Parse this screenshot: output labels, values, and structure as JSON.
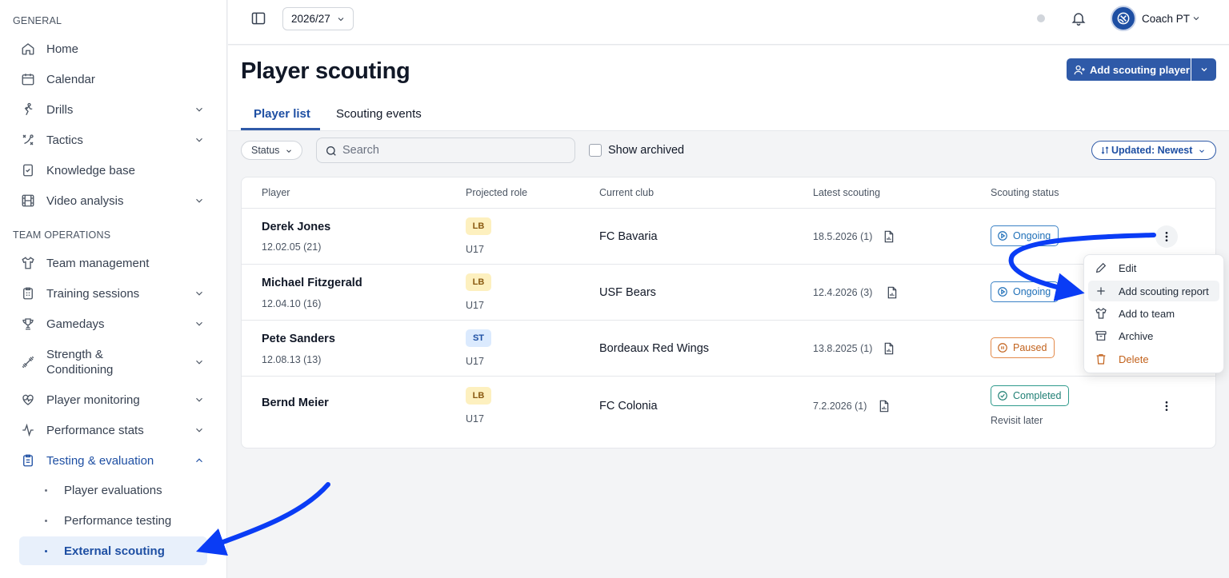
{
  "sidebar": {
    "general_title": "GENERAL",
    "team_ops_title": "TEAM OPERATIONS",
    "items": {
      "home": "Home",
      "calendar": "Calendar",
      "drills": "Drills",
      "tactics": "Tactics",
      "knowledge": "Knowledge base",
      "video": "Video analysis",
      "team_mgmt": "Team management",
      "training": "Training sessions",
      "gamedays": "Gamedays",
      "strength_1": "Strength &",
      "strength_2": "Conditioning",
      "monitoring": "Player monitoring",
      "perf_stats": "Performance stats",
      "testing": "Testing & evaluation"
    },
    "sub_items": {
      "player_evals": "Player evaluations",
      "perf_testing": "Performance testing",
      "external_scouting": "External scouting"
    }
  },
  "topbar": {
    "season": "2026/27",
    "user_name": "Coach PT"
  },
  "page": {
    "title": "Player scouting",
    "add_button": "Add scouting player",
    "tabs": [
      "Player list",
      "Scouting events"
    ]
  },
  "filters": {
    "status": "Status",
    "search_placeholder": "Search",
    "show_archived": "Show archived",
    "sort": "Updated: Newest"
  },
  "table": {
    "columns": [
      "Player",
      "Projected role",
      "Current club",
      "Latest scouting",
      "Scouting status"
    ],
    "rows": [
      {
        "name": "Derek Jones",
        "dob": "12.02.05 (21)",
        "role": "LB",
        "team": "U17",
        "club": "FC Bavaria",
        "latest": "18.5.2026 (1)",
        "status": "Ongoing",
        "note": ""
      },
      {
        "name": "Michael Fitzgerald",
        "dob": "12.04.10 (16)",
        "role": "LB",
        "team": "U17",
        "club": "USF Bears",
        "latest": "12.4.2026 (3)",
        "status": "Ongoing",
        "note": ""
      },
      {
        "name": "Pete Sanders",
        "dob": "12.08.13 (13)",
        "role": "ST",
        "team": "U17",
        "club": "Bordeaux Red Wings",
        "latest": "13.8.2025 (1)",
        "status": "Paused",
        "note": ""
      },
      {
        "name": "Bernd Meier",
        "dob": "",
        "role": "LB",
        "team": "U17",
        "club": "FC Colonia",
        "latest": "7.2.2026 (1)",
        "status": "Completed",
        "note": "Revisit later"
      }
    ]
  },
  "context_menu": {
    "items": [
      "Edit",
      "Add scouting report",
      "Add to team",
      "Archive",
      "Delete"
    ]
  },
  "colors": {
    "accent": "#2f5aa8",
    "ongoing": "#1e6fb8",
    "paused": "#c2621c",
    "completed": "#1f7f74",
    "annotation_arrow": "#0a3cf5"
  }
}
